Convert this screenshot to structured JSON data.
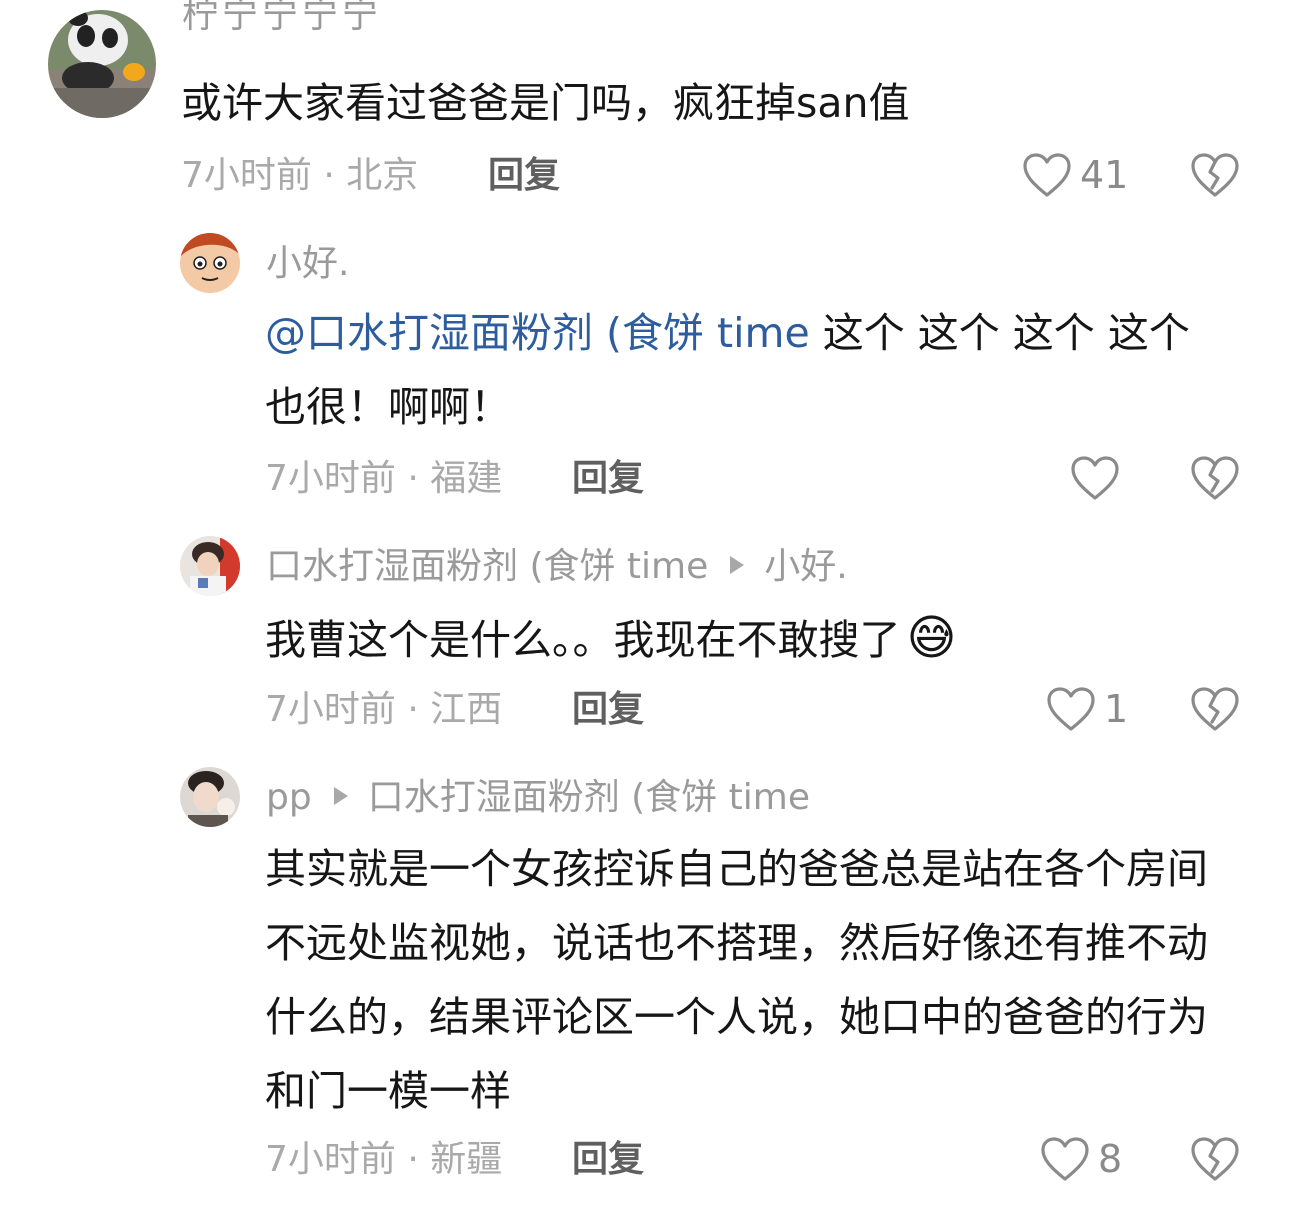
{
  "comments": [
    {
      "username": "柠宁宁宁宁",
      "text": "或许大家看过爸爸是门吗，疯狂掉san值",
      "meta": "7小时前 · 北京",
      "reply_label": "回复",
      "likes": "41"
    },
    {
      "username": "小好.",
      "mention": "@口水打湿面粉剂 (食饼 time",
      "text": " 这个 这个 这个 这个也很！啊啊！",
      "meta": "7小时前 · 福建",
      "reply_label": "回复",
      "likes": ""
    },
    {
      "username": "口水打湿面粉剂 (食饼 time",
      "reply_to": "小好.",
      "text": "我曹这个是什么。。我现在不敢搜了",
      "emoji": "😅",
      "meta": "7小时前 · 江西",
      "reply_label": "回复",
      "likes": "1"
    },
    {
      "username": "pp",
      "reply_to": "口水打湿面粉剂 (食饼 time",
      "text": "其实就是一个女孩控诉自己的爸爸总是站在各个房间不远处监视她，说话也不搭理，然后好像还有推不动什么的，结果评论区一个人说，她口中的爸爸的行为和门一模一样",
      "meta": "7小时前 · 新疆",
      "reply_label": "回复",
      "likes": "8"
    }
  ]
}
